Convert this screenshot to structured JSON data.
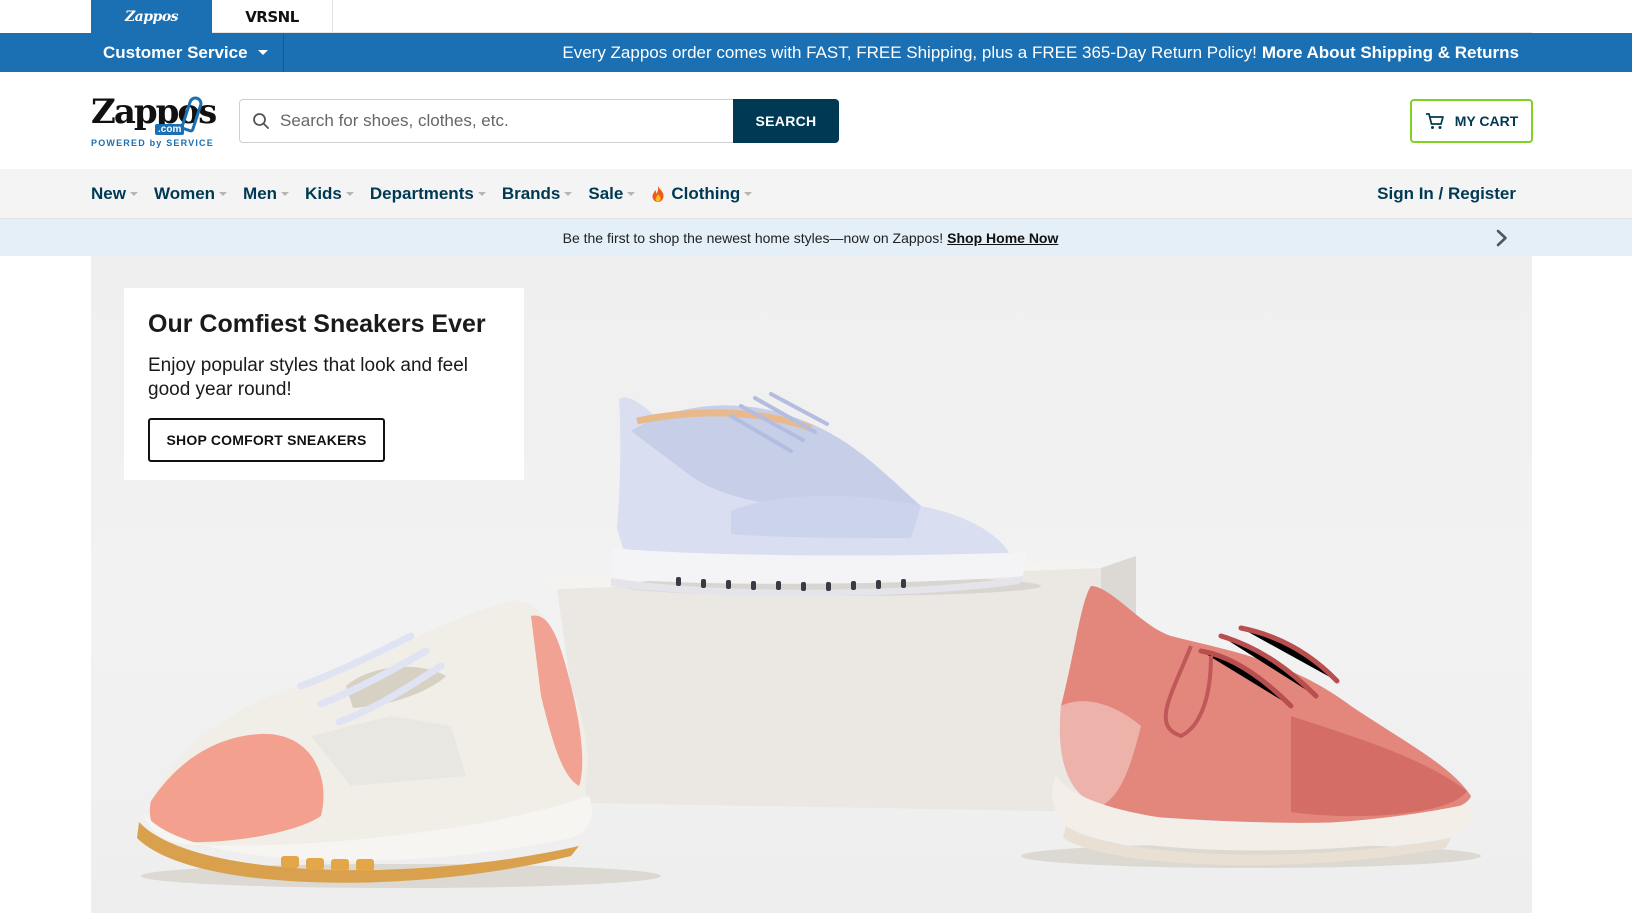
{
  "site_switcher": {
    "tabs": [
      {
        "label": "Zappos",
        "active": true
      },
      {
        "label": "VRSNL",
        "active": false
      }
    ]
  },
  "shipping_bar": {
    "customer_service": "Customer Service",
    "message": "Every Zappos order comes with FAST, FREE Shipping, plus a FREE 365-Day Return Policy!",
    "link": "More About Shipping & Returns"
  },
  "header": {
    "logo": {
      "word": "Zappos",
      "com": ".com",
      "tagline": "POWERED by SERVICE"
    },
    "search": {
      "placeholder": "Search for shoes, clothes, etc.",
      "value": "",
      "button": "SEARCH"
    },
    "cart": {
      "label": "MY CART"
    }
  },
  "nav": {
    "items": [
      {
        "label": "New"
      },
      {
        "label": "Women"
      },
      {
        "label": "Men"
      },
      {
        "label": "Kids"
      },
      {
        "label": "Departments"
      },
      {
        "label": "Brands"
      },
      {
        "label": "Sale"
      },
      {
        "label": "Clothing",
        "icon": "flame-icon"
      }
    ],
    "sign_in": "Sign In / Register"
  },
  "promo": {
    "text": "Be the first to shop the newest home styles—now on Zappos!",
    "link": "Shop Home Now"
  },
  "hero": {
    "title": "Our Comfiest Sneakers Ever",
    "subtitle": "Enjoy popular styles that look and feel good year round!",
    "cta": "SHOP COMFORT SNEAKERS"
  },
  "colors": {
    "brand_blue": "#1b6fb3",
    "nav_text": "#003953",
    "cart_border": "#7ed321",
    "promo_bg": "#e4eff7"
  }
}
